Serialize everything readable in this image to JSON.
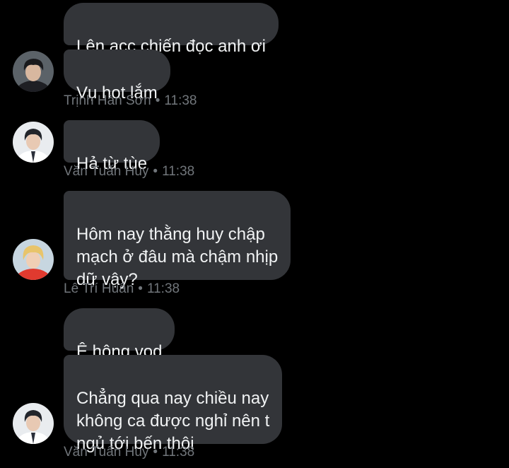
{
  "messages": [
    {
      "text": "Lên acc chiến đọc anh ơi"
    },
    {
      "text": "Vụ hot lắm"
    },
    {
      "text": "Hả từ tùe"
    },
    {
      "text": "Hôm nay thằng huy chập\nmạch ở đâu mà chậm nhịp\ndữ vậy?"
    },
    {
      "text": "Ê hông vod"
    },
    {
      "text": "Chẳng qua nay chiều nay\nkhông ca được nghỉ nên t\nngủ tới bến thôi"
    }
  ],
  "groups": [
    {
      "sender": "Trịnh Hàn Sơn",
      "separator": "•",
      "time": "11:38",
      "avatar_icon": "avatar-dark-hair-icon"
    },
    {
      "sender": "Văn Tuấn Huy",
      "separator": "•",
      "time": "11:38",
      "avatar_icon": "avatar-white-shirt-icon"
    },
    {
      "sender": "Lê Trí Huân",
      "separator": "•",
      "time": "11:38",
      "avatar_icon": "avatar-blonde-hair-icon"
    },
    {
      "sender": "Văn Tuấn Huy",
      "separator": "•",
      "time": "11:38",
      "avatar_icon": "avatar-white-shirt-icon"
    }
  ],
  "colors": {
    "background": "#000000",
    "bubble": "#333539",
    "bubble_text": "#f1f3f4",
    "meta_text": "#71767b"
  }
}
